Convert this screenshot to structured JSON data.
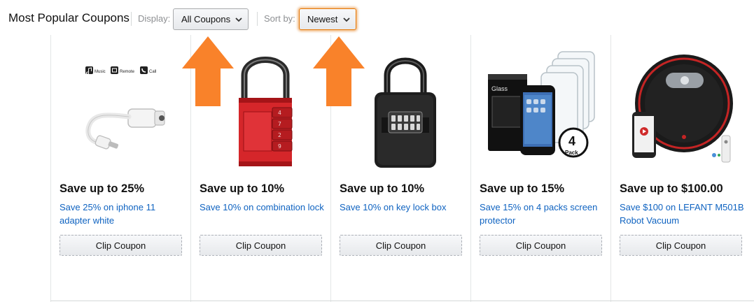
{
  "toolbar": {
    "title": "Most Popular Coupons",
    "display_label": "Display:",
    "display_value": "All Coupons",
    "sort_label": "Sort by:",
    "sort_value": "Newest"
  },
  "coupons": [
    {
      "title": "Save up to 25%",
      "description": "Save 25% on iphone 11 adapter white",
      "button": "Clip Coupon",
      "image": "headphone-adapter",
      "image_icon_labels": [
        "Music",
        "Remote",
        "Call"
      ]
    },
    {
      "title": "Save up to 10%",
      "description": "Save 10% on combination lock",
      "button": "Clip Coupon",
      "image": "red-combination-padlock"
    },
    {
      "title": "Save up to 10%",
      "description": "Save 10% on key lock box",
      "button": "Clip Coupon",
      "image": "black-key-lock-box"
    },
    {
      "title": "Save up to 15%",
      "description": "Save 15% on 4 packs screen protector",
      "button": "Clip Coupon",
      "image": "screen-protector-pack",
      "image_text": {
        "box": "Glass",
        "badge_number": "4",
        "badge_word": "Pack"
      }
    },
    {
      "title": "Save up to $100.00",
      "description": "Save $100 on LEFANT M501B Robot Vacuum",
      "button": "Clip Coupon",
      "image": "robot-vacuum"
    }
  ],
  "colors": {
    "link": "#0f63c1",
    "focus": "#e77600",
    "arrow": "#f9822a",
    "lock_red": "#d5262a"
  },
  "overlay": [
    "arrow-up-icon",
    "arrow-up-icon"
  ]
}
